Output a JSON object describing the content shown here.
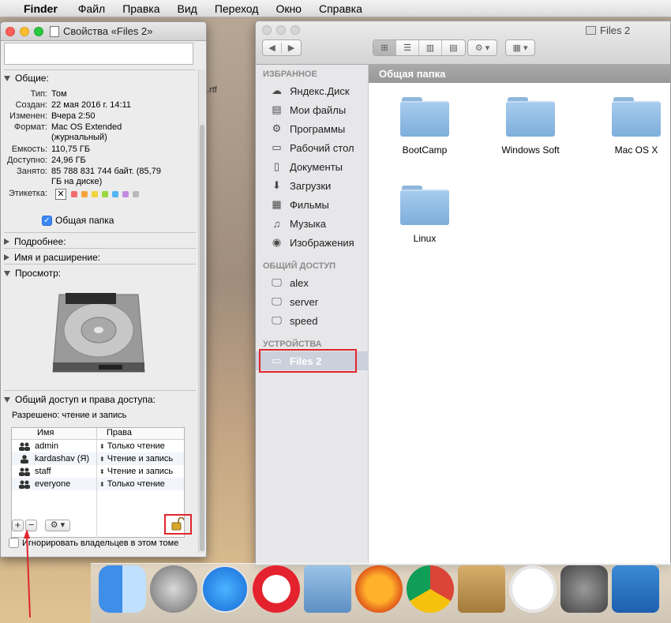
{
  "menubar": {
    "app": "Finder",
    "items": [
      "Файл",
      "Правка",
      "Вид",
      "Переход",
      "Окно",
      "Справка"
    ]
  },
  "desktop": {
    "rtf_label": ".rtf"
  },
  "info_window": {
    "title": "Свойства «Files 2»",
    "general": {
      "header": "Общие:",
      "rows": [
        {
          "k": "Тип:",
          "v": "Том"
        },
        {
          "k": "Создан:",
          "v": "22 мая 2016 г. 14:11"
        },
        {
          "k": "Изменен:",
          "v": "Вчера 2:50"
        },
        {
          "k": "Формат:",
          "v": "Mac OS Extended"
        },
        {
          "k": "",
          "v": "(журнальный)"
        },
        {
          "k": "Емкость:",
          "v": "110,75 ГБ"
        },
        {
          "k": "Доступно:",
          "v": "24,96 ГБ"
        },
        {
          "k": "Занято:",
          "v": "85 788 831 744 байт. (85,79"
        },
        {
          "k": "",
          "v": "ГБ на диске)"
        }
      ],
      "label_key": "Этикетка:",
      "label_x": "✕",
      "label_colors": [
        "#f26b6b",
        "#f5a53c",
        "#f2d23c",
        "#9bd63f",
        "#55b5f5",
        "#c48ae0",
        "#b9b9b9"
      ],
      "shared_folder": "Общая папка",
      "shared_checked": true
    },
    "more_info": "Подробнее:",
    "name_ext": "Имя и расширение:",
    "preview": "Просмотр:",
    "sharing": {
      "header": "Общий доступ и права доступа:",
      "allowed": "Разрешено: чтение и запись",
      "col_name": "Имя",
      "col_rights": "Права",
      "rows": [
        {
          "user": "admin",
          "right": "Только чтение"
        },
        {
          "user": "kardashav (Я)",
          "right": "Чтение и запись"
        },
        {
          "user": "staff",
          "right": "Чтение и запись"
        },
        {
          "user": "everyone",
          "right": "Только чтение"
        }
      ],
      "plus": "+",
      "minus": "−",
      "gear": "⚙ ▾",
      "ignore_owners": "Игнорировать владельцев в этом томе"
    }
  },
  "finder": {
    "title": "Files 2",
    "path": "Общая папка",
    "sidebar": {
      "favorites_header": "ИЗБРАННОЕ",
      "favorites": [
        {
          "label": "Яндекс.Диск",
          "icon": "yandex-disk-icon",
          "glyph": "☁"
        },
        {
          "label": "Мои файлы",
          "icon": "all-files-icon",
          "glyph": "▤"
        },
        {
          "label": "Программы",
          "icon": "applications-icon",
          "glyph": "⚙"
        },
        {
          "label": "Рабочий стол",
          "icon": "desktop-icon",
          "glyph": "▭"
        },
        {
          "label": "Документы",
          "icon": "documents-icon",
          "glyph": "▯"
        },
        {
          "label": "Загрузки",
          "icon": "downloads-icon",
          "glyph": "⬇"
        },
        {
          "label": "Фильмы",
          "icon": "movies-icon",
          "glyph": "▦"
        },
        {
          "label": "Музыка",
          "icon": "music-icon",
          "glyph": "♫"
        },
        {
          "label": "Изображения",
          "icon": "pictures-icon",
          "glyph": "◉"
        }
      ],
      "shared_header": "ОБЩИЙ ДОСТУП",
      "shared": [
        {
          "label": "alex"
        },
        {
          "label": "server"
        },
        {
          "label": "speed"
        }
      ],
      "devices_header": "УСТРОЙСТВА",
      "devices": [
        {
          "label": "Files 2",
          "selected": true
        }
      ]
    },
    "items": [
      "BootCamp",
      "Windows Soft",
      "Mac OS X",
      "Linux"
    ]
  },
  "dock": {
    "apps": [
      "finder",
      "launchpad",
      "app-store",
      "opera",
      "mail",
      "firefox",
      "chrome",
      "contacts",
      "itunes",
      "system-preferences",
      "word"
    ]
  },
  "colors": {
    "highlight": "#e0262c",
    "accent": "#3b86f7"
  }
}
